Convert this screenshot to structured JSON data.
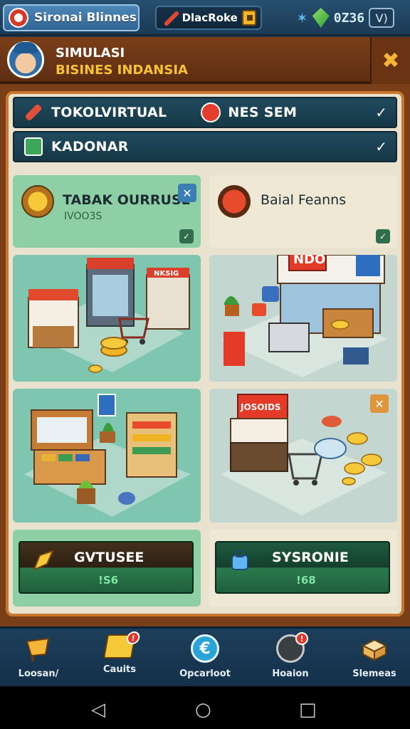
{
  "topbar": {
    "app_name": "Sironai Blinnes",
    "player_name": "DlacRoke",
    "currency_amount": "0Z36",
    "menu_label": "V)",
    "icons": [
      "app-logo-icon",
      "wrench-icon",
      "coin-icon",
      "star-icon",
      "gem-icon"
    ]
  },
  "header": {
    "title_line1": "SIMULASI",
    "title_line2": "BISINES INDANSIA",
    "close_icon": "close-x-icon"
  },
  "filters": [
    {
      "label": "TOKOLVIRTUAL",
      "icon": "tool-icon",
      "extra_label": "NES SEM",
      "extra_icon": "red-badge-icon"
    },
    {
      "label": "KADONAR",
      "icon": "shop-icon"
    }
  ],
  "cards": [
    {
      "title": "TABAK OURRUSE",
      "subtitle": "IVOO3S",
      "badge_icon": "close-x-icon",
      "check_icon": "check-icon"
    },
    {
      "title": "Baial Feanns",
      "check_icon": "check-icon"
    }
  ],
  "scenes": [
    {
      "sign": "NKSIG"
    },
    {
      "sign": "NDO"
    },
    {
      "sign": ""
    },
    {
      "sign": "JOSOIDS",
      "badge_icon": "close-x-icon"
    }
  ],
  "stats": [
    {
      "label": "GVTUSEE",
      "value": "!S6",
      "icon": "pickaxe-icon"
    },
    {
      "label": "SYSRONIE",
      "value": "!68",
      "icon": "bag-icon"
    }
  ],
  "bottom_nav": [
    {
      "label": "Loosan/",
      "icon": "cart-icon",
      "notification": ""
    },
    {
      "label": "Cauits",
      "icon": "card-icon",
      "notification": "!"
    },
    {
      "label": "Opcarloot",
      "icon": "euro-coin-icon",
      "notification": ""
    },
    {
      "label": "Hoaion",
      "icon": "tools-icon",
      "notification": "!"
    },
    {
      "label": "Slemeas",
      "icon": "box-icon",
      "notification": ""
    }
  ],
  "system_nav": [
    "back-icon",
    "home-icon",
    "recents-icon"
  ],
  "colors": {
    "topbar": "#1b3a55",
    "header": "#7a3f19",
    "panel_bg": "#e9e2cf",
    "card_green": "#8fcfa6",
    "card_cream": "#efe8d4",
    "accent_gold": "#f7c236",
    "filter_bar": "#1f4a5e"
  }
}
